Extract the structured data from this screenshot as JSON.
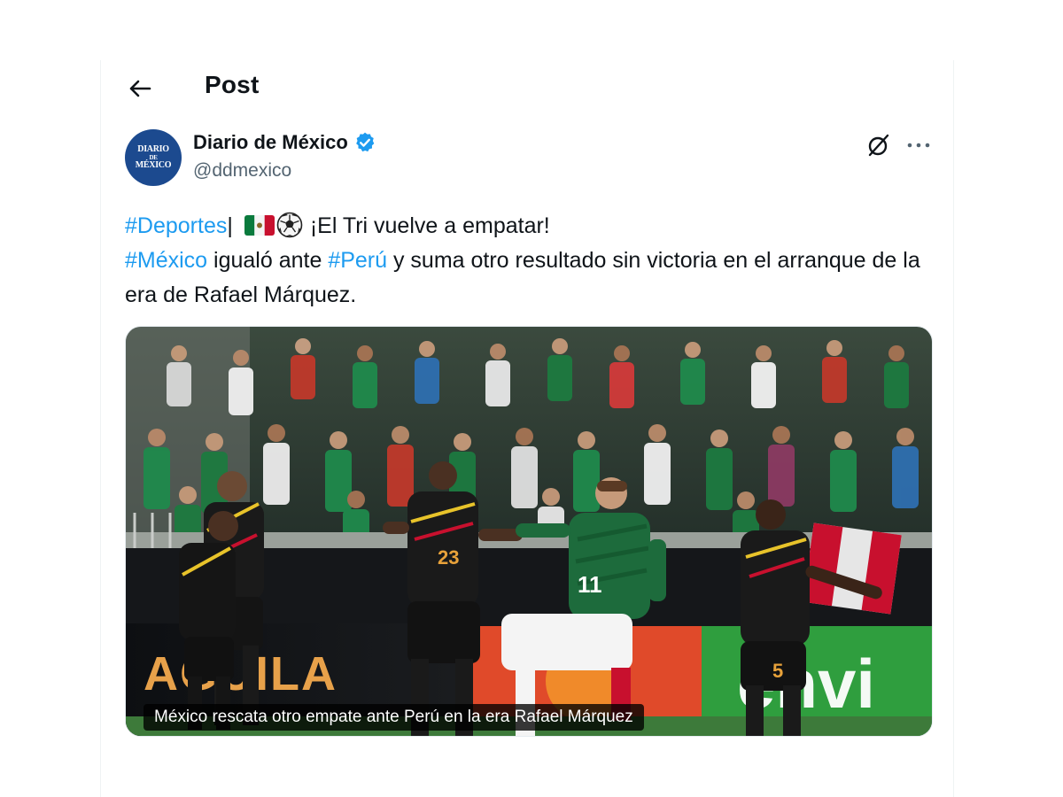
{
  "header": {
    "title": "Post"
  },
  "author": {
    "display_name": "Diario de México",
    "handle": "@ddmexico",
    "avatar_text": [
      "DIARIO",
      "DE",
      "MÉXICO"
    ]
  },
  "tweet": {
    "tag_deportes": "#Deportes",
    "sep": "|",
    "line1_rest": "¡El Tri vuelve a empatar!",
    "tag_mexico": "#México",
    "mid_text": " igualó ante ",
    "tag_peru": "#Perú",
    "rest_text": " y suma otro resultado sin victoria en el arranque de la era de Rafael Márquez."
  },
  "media": {
    "caption": "México rescata otro empate ante Perú en la era Rafael Márquez",
    "board_left": "AGUILA",
    "board_right": "envi",
    "jersey_numbers": [
      "11",
      "23",
      "5"
    ]
  },
  "icons": [
    "back-arrow-icon",
    "verified-badge-icon",
    "grok-icon",
    "more-options-icon",
    "mexico-flag-icon",
    "soccer-ball-icon"
  ],
  "colors": {
    "accent": "#1d9bf0",
    "avatar_bg": "#1c4a8f",
    "text": "#0f1419",
    "muted": "#536471"
  }
}
